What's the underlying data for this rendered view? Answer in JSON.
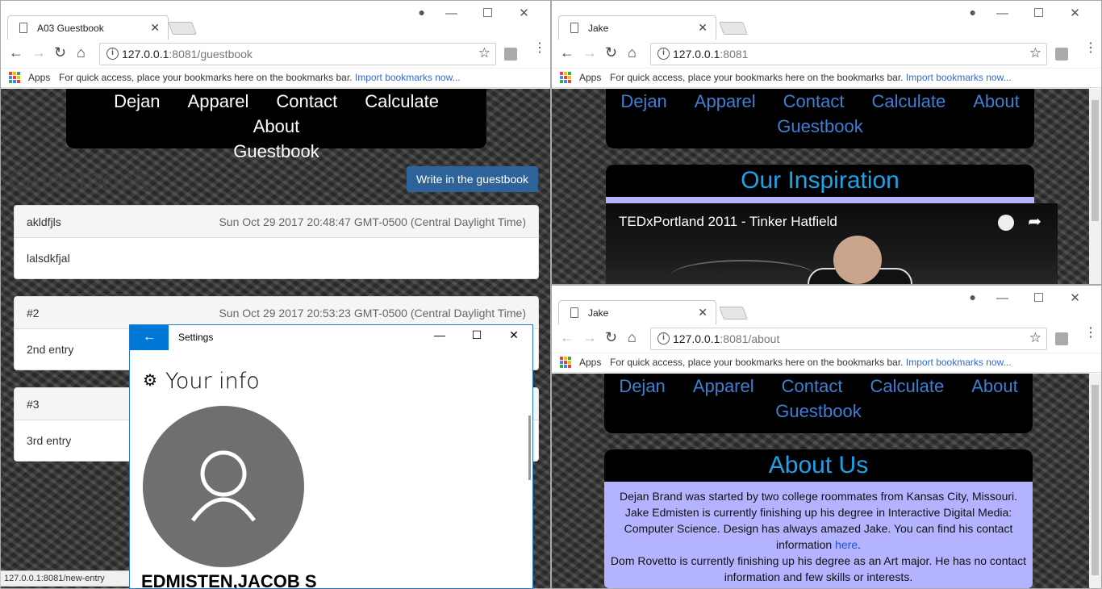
{
  "left_window": {
    "tab_title": "A03 Guestbook",
    "url_host": "127.0.0.1",
    "url_rest": ":8081/guestbook",
    "bookmarks": {
      "apps": "Apps",
      "hint": "For quick access, place your bookmarks here on the bookmarks bar.",
      "import_link": "Import bookmarks now..."
    },
    "menu": [
      "Dejan",
      "Apparel",
      "Contact",
      "Calculate",
      "About",
      "Guestbook"
    ],
    "page_heading": "Guestbook",
    "write_button": "Write in the guestbook",
    "entries": [
      {
        "name": "akldfjls",
        "date": "Sun Oct 29 2017 20:48:47 GMT-0500 (Central Daylight Time)",
        "body": "lalsdkfjal"
      },
      {
        "name": "#2",
        "date": "Sun Oct 29 2017 20:53:23 GMT-0500 (Central Daylight Time)",
        "body": "2nd entry"
      },
      {
        "name": "#3",
        "date": "",
        "body": "3rd entry"
      }
    ],
    "status_url": "127.0.0.1:8081/new-entry"
  },
  "settings_window": {
    "title": "Settings",
    "back_glyph": "←",
    "minimize_glyph": "—",
    "maximize_glyph": "☐",
    "close_glyph": "✕",
    "heading": "Your info",
    "user_name": "EDMISTEN,JACOB S"
  },
  "top_right_window": {
    "tab_title": "Jake",
    "url_host": "127.0.0.1",
    "url_rest": ":8081",
    "bookmarks": {
      "apps": "Apps",
      "hint": "For quick access, place your bookmarks here on the bookmarks bar.",
      "import_link": "Import bookmarks now..."
    },
    "menu": [
      "Dejan",
      "Apparel",
      "Contact",
      "Calculate",
      "About",
      "Guestbook"
    ],
    "section_title": "Our Inspiration",
    "video_title": "TEDxPortland 2011 - Tinker Hatfield"
  },
  "bottom_right_window": {
    "tab_title": "Jake",
    "url_host": "127.0.0.1",
    "url_rest": ":8081/about",
    "bookmarks": {
      "apps": "Apps",
      "hint": "For quick access, place your bookmarks here on the bookmarks bar.",
      "import_link": "Import bookmarks now..."
    },
    "menu": [
      "Dejan",
      "Apparel",
      "Contact",
      "Calculate",
      "About",
      "Guestbook"
    ],
    "section_title": "About Us",
    "about_text_1": "Dejan Brand was started by two college roommates from Kansas City, Missouri. Jake Edmisten is currently finishing up his degree in Interactive Digital Media: Computer Science. Design has always amazed Jake. You can find his contact information",
    "about_link": "here",
    "about_text_2": "Dom Rovetto is currently finishing up his degree as an Art major. He has no contact information and few skills or interests."
  },
  "colors": {
    "menu_blue": "#3e7fd3",
    "title_cyan": "#1ca3e8",
    "about_bg": "#b3b3ff",
    "button_blue": "#2d6398",
    "win10_blue": "#0078d7"
  }
}
